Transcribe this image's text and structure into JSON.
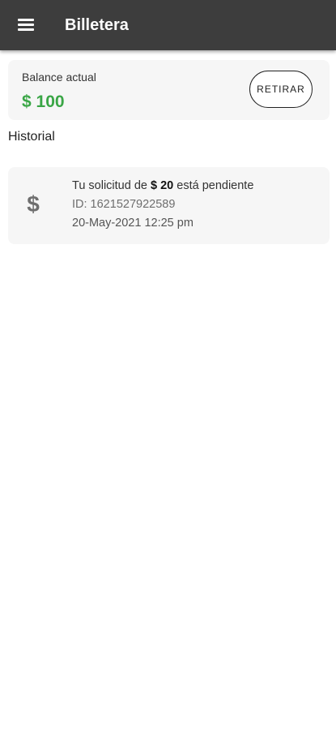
{
  "app_bar": {
    "title": "Billetera",
    "menu_icon": "hamburger-menu-icon",
    "background_color": "#3d3d3d"
  },
  "balance": {
    "label": "Balance actual",
    "amount": "$ 100",
    "amount_color": "#3aa646",
    "withdraw_button_label": "RETIRAR"
  },
  "history": {
    "title": "Historial",
    "items": [
      {
        "icon": "dollar-icon",
        "icon_glyph": "$",
        "message_prefix": "Tu solicitud de",
        "amount": "$ 20",
        "message_suffix": "está pendiente",
        "id_text": "ID: 1621527922589",
        "datetime": "20-May-2021 12:25 pm"
      }
    ]
  }
}
